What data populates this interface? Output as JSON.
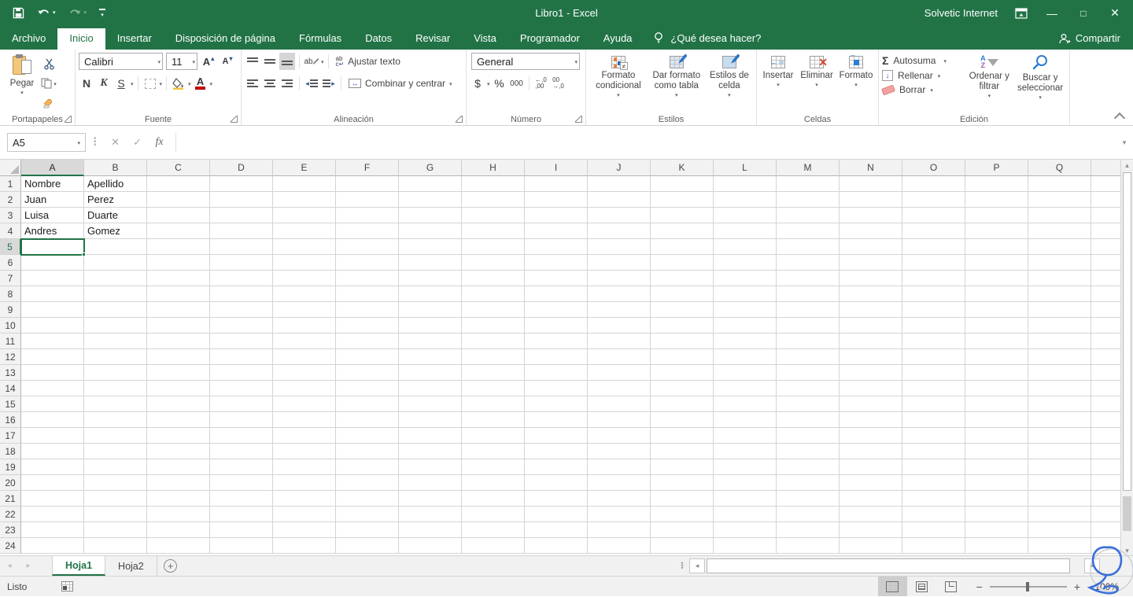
{
  "colors": {
    "excel_green": "#217346",
    "annotation_blue": "#3a6fd8",
    "font_color_red": "#c00000",
    "fill_yellow": "#f5c342",
    "selection_border": "#217346"
  },
  "titlebar": {
    "title": "Libro1  -  Excel",
    "user": "Solvetic Internet"
  },
  "ribbon_tabs": [
    {
      "label": "Archivo",
      "active": false
    },
    {
      "label": "Inicio",
      "active": true
    },
    {
      "label": "Insertar",
      "active": false
    },
    {
      "label": "Disposición de página",
      "active": false
    },
    {
      "label": "Fórmulas",
      "active": false
    },
    {
      "label": "Datos",
      "active": false
    },
    {
      "label": "Revisar",
      "active": false
    },
    {
      "label": "Vista",
      "active": false
    },
    {
      "label": "Programador",
      "active": false
    },
    {
      "label": "Ayuda",
      "active": false
    }
  ],
  "tell_me": "¿Qué desea hacer?",
  "share_label": "Compartir",
  "ribbon": {
    "clipboard": {
      "group": "Portapapeles",
      "paste": "Pegar"
    },
    "font": {
      "group": "Fuente",
      "family": "Calibri",
      "size": "11",
      "bold": "N",
      "italic": "K",
      "underline": "S"
    },
    "alignment": {
      "group": "Alineación",
      "wrap": "Ajustar texto",
      "merge": "Combinar y centrar"
    },
    "number": {
      "group": "Número",
      "format": "General",
      "currency": "$",
      "percent": "%",
      "thousand": "000",
      "inc_dec": "←,0\n,00",
      "dec_dec": "00\n→,0"
    },
    "styles": {
      "group": "Estilos",
      "conditional": "Formato\ncondicional",
      "as_table": "Dar formato\ncomo tabla",
      "cell_styles": "Estilos de\ncelda"
    },
    "cells": {
      "group": "Celdas",
      "insert": "Insertar",
      "delete": "Eliminar",
      "format": "Formato"
    },
    "editing": {
      "group": "Edición",
      "autosum": "Autosuma",
      "fill": "Rellenar",
      "clear": "Borrar",
      "sort": "Ordenar y\nfiltrar",
      "find": "Buscar y\nseleccionar",
      "sort_a": "A",
      "sort_z": "Z"
    }
  },
  "formula_bar": {
    "name_box": "A5",
    "fx": "fx",
    "formula": ""
  },
  "grid": {
    "columns": [
      "A",
      "B",
      "C",
      "D",
      "E",
      "F",
      "G",
      "H",
      "I",
      "J",
      "K",
      "L",
      "M",
      "N",
      "O",
      "P",
      "Q"
    ],
    "row_count": 24,
    "selected": {
      "col": "A",
      "row": 5
    },
    "cells": [
      {
        "ref": "A1",
        "text": "Nombre"
      },
      {
        "ref": "B1",
        "text": "Apellido"
      },
      {
        "ref": "A2",
        "text": "Juan"
      },
      {
        "ref": "B2",
        "text": "Perez"
      },
      {
        "ref": "A3",
        "text": "Luisa"
      },
      {
        "ref": "B3",
        "text": "Duarte"
      },
      {
        "ref": "A4",
        "text": "Andres"
      },
      {
        "ref": "B4",
        "text": "Gomez"
      }
    ]
  },
  "sheet_tabs": [
    {
      "label": "Hoja1",
      "active": true
    },
    {
      "label": "Hoja2",
      "active": false
    }
  ],
  "status_bar": {
    "mode": "Listo",
    "zoom": "100%"
  }
}
